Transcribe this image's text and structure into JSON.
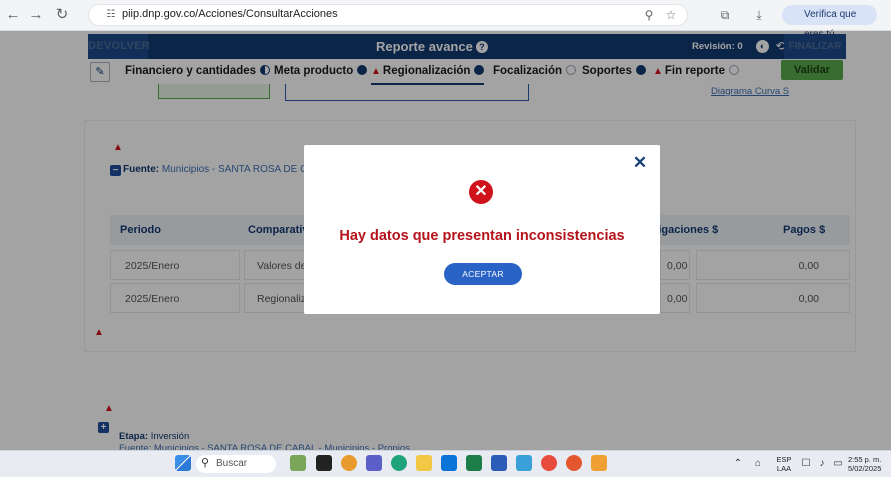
{
  "browser": {
    "url": "piip.dnp.gov.co/Acciones/ConsultarAcciones",
    "verify_label": "Verifica que eres tú"
  },
  "header": {
    "devolver_label": "DEVOLVER",
    "title": "Reporte avance",
    "revision_label": "Revisión: 0",
    "finalizar_label": "FINALIZAR"
  },
  "tabs": [
    {
      "label": "Financiero y cantidades",
      "status": "partial"
    },
    {
      "label": "Meta producto",
      "status": "complete"
    },
    {
      "label": "Regionalización",
      "status": "complete",
      "warning": true,
      "active": true
    },
    {
      "label": "Focalización",
      "status": "empty"
    },
    {
      "label": "Soportes",
      "status": "complete"
    },
    {
      "label": "Fin reporte",
      "status": "empty",
      "warning": true
    }
  ],
  "validar_label": "Validar",
  "diagrama_link": "Diagrama Curva S",
  "content": {
    "fuente_label": "Fuente:",
    "fuente_value": "Municipios - SANTA ROSA DE CABAL",
    "columns": {
      "periodo": "Periodo",
      "comparativo": "Comparativo",
      "obligaciones": "Obligaciones $",
      "pagos": "Pagos $"
    },
    "rows": [
      {
        "periodo": "2025/Enero",
        "comparativo": "Valores de",
        "obligaciones": "0,00",
        "pagos": "0,00"
      },
      {
        "periodo": "2025/Enero",
        "comparativo": "Regionaliz",
        "obligaciones": "0,00",
        "pagos": "0,00"
      }
    ],
    "etapa_label": "Etapa:",
    "etapa_value": "Inversión",
    "etapa_sub": "Fuente: Municipios - SANTA ROSA DE CABAL - Municipios - Propios"
  },
  "modal": {
    "message": "Hay datos que presentan inconsistencias",
    "ok_label": "ACEPTAR"
  },
  "taskbar": {
    "search_placeholder": "Buscar",
    "lang_top": "ESP",
    "lang_bottom": "LAA",
    "time": "2:55 p. m.",
    "date": "5/02/2025"
  },
  "colors": {
    "primary": "#123a73",
    "accent_green": "#5aa94d",
    "error": "#d0121b",
    "button_blue": "#2a63c6"
  }
}
